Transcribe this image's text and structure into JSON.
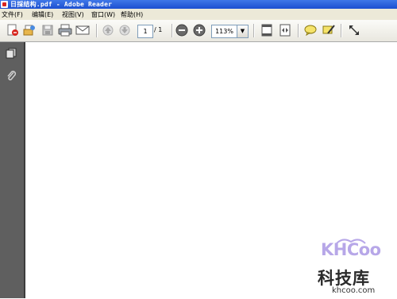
{
  "window": {
    "title": "日採结构.pdf - Adobe Reader"
  },
  "menu": [
    "文件(F)",
    "编辑(E)",
    "视图(V)",
    "窗口(W)",
    "帮助(H)"
  ],
  "toolbar": {
    "page_current": "1",
    "page_total": "/ 1",
    "zoom": "113%",
    "dropdown_arrow": "▼"
  },
  "watermark": {
    "logo": "KHCoo",
    "name": "科技库",
    "domain": "khcoo.com"
  }
}
